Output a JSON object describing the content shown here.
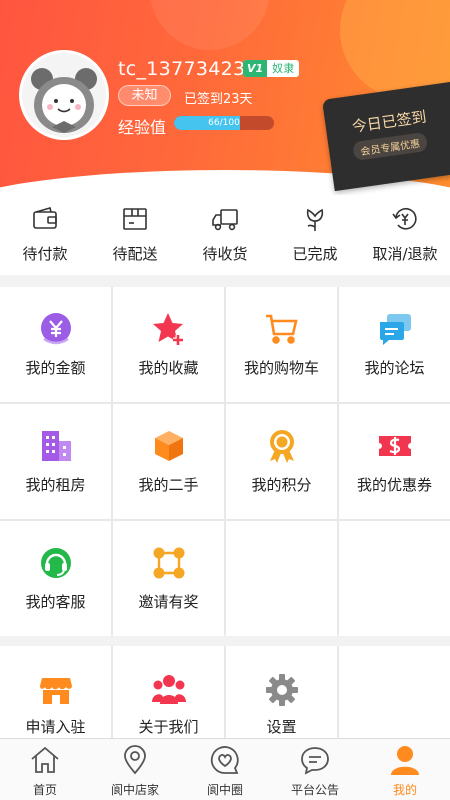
{
  "profile": {
    "username": "tc_13773423",
    "vip_level": "V1",
    "vip_title": "奴隶",
    "gender": "未知",
    "signed_days": "已签到23天",
    "exp_label": "经验值",
    "exp_text": "66/100",
    "exp_progress": 0.66
  },
  "signin": {
    "title": "今日已签到",
    "subtitle": "会员专属优惠"
  },
  "orders": [
    {
      "label": "待付款",
      "icon": "wallet-icon"
    },
    {
      "label": "待配送",
      "icon": "package-icon"
    },
    {
      "label": "待收货",
      "icon": "truck-icon"
    },
    {
      "label": "已完成",
      "icon": "flower-icon"
    },
    {
      "label": "取消/退款",
      "icon": "refund-icon"
    }
  ],
  "services": [
    {
      "label": "我的金额",
      "icon": "money-icon",
      "color": "#9b5de5"
    },
    {
      "label": "我的收藏",
      "icon": "star-plus-icon",
      "color": "#f2364f"
    },
    {
      "label": "我的购物车",
      "icon": "cart-icon",
      "color": "#ff8a1e"
    },
    {
      "label": "我的论坛",
      "icon": "chat-icon",
      "color": "#2ba6e8"
    },
    {
      "label": "我的租房",
      "icon": "building-icon",
      "color": "#a45ae6"
    },
    {
      "label": "我的二手",
      "icon": "box-icon",
      "color": "#ff8a1e"
    },
    {
      "label": "我的积分",
      "icon": "medal-icon",
      "color": "#f5a623"
    },
    {
      "label": "我的优惠券",
      "icon": "coupon-icon",
      "color": "#f2364f"
    },
    {
      "label": "我的客服",
      "icon": "headset-icon",
      "color": "#22b84a"
    },
    {
      "label": "邀请有奖",
      "icon": "network-icon",
      "color": "#f5a623"
    }
  ],
  "extras": [
    {
      "label": "申请入驻",
      "icon": "store-icon",
      "color": "#ff8a1e"
    },
    {
      "label": "关于我们",
      "icon": "group-icon",
      "color": "#f2364f"
    },
    {
      "label": "设置",
      "icon": "gear-icon",
      "color": "#8a8a8a"
    }
  ],
  "tabs": [
    {
      "label": "首页",
      "icon": "home-icon"
    },
    {
      "label": "阆中店家",
      "icon": "location-icon"
    },
    {
      "label": "阆中圈",
      "icon": "heart-bubble-icon"
    },
    {
      "label": "平台公告",
      "icon": "message-icon"
    },
    {
      "label": "我的",
      "icon": "user-icon",
      "active": true
    }
  ],
  "colors": {
    "header_start": "#ff5540",
    "header_end": "#ff8d2e",
    "accent": "#ff8a1e"
  }
}
